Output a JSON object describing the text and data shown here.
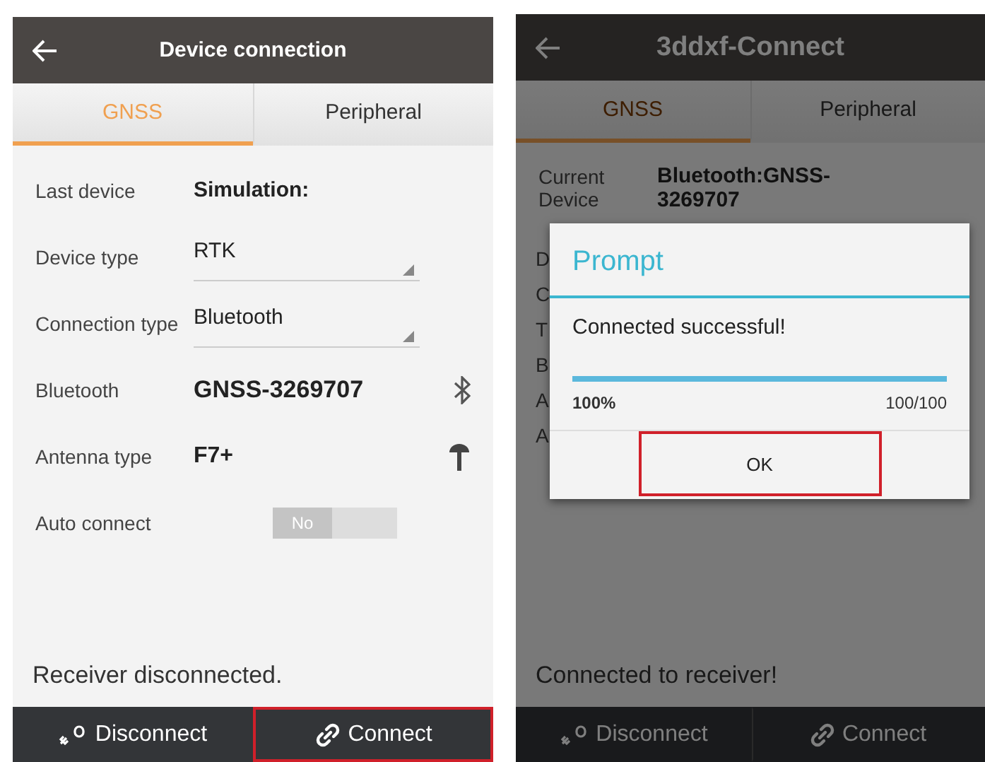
{
  "screens": [
    {
      "title": "Device connection",
      "tabs": [
        {
          "label": "GNSS",
          "selected": true
        },
        {
          "label": "Peripheral",
          "selected": false
        }
      ],
      "fields": [
        {
          "kind": "text",
          "label": "Last device",
          "value": "Simulation:"
        },
        {
          "kind": "dropdown",
          "label": "Device type",
          "value": "RTK"
        },
        {
          "kind": "dropdown",
          "label": "Connection type",
          "value": "Bluetooth"
        },
        {
          "kind": "bluetooth",
          "label": "Bluetooth",
          "value": "GNSS-3269707"
        },
        {
          "kind": "antenna",
          "label": "Antenna type",
          "value": "F7+"
        },
        {
          "kind": "toggle",
          "label": "Auto connect",
          "value": "No",
          "on": false
        }
      ],
      "status": "Receiver disconnected.",
      "buttons": [
        {
          "kind": "disconnect",
          "label": "Disconnect",
          "highlighted": false
        },
        {
          "kind": "connect",
          "label": "Connect",
          "highlighted": true
        }
      ]
    },
    {
      "title": "3ddxf-Connect",
      "tabs": [
        {
          "label": "GNSS",
          "selected": true
        },
        {
          "label": "Peripheral",
          "selected": false
        }
      ],
      "fields": [
        {
          "kind": "text",
          "label": "Current Device",
          "value": "Bluetooth:GNSS-3269707"
        },
        {
          "kind": "partial",
          "label": "D"
        },
        {
          "kind": "partial",
          "label": "C"
        },
        {
          "kind": "partial",
          "label": "T"
        },
        {
          "kind": "partial",
          "label": "B"
        },
        {
          "kind": "partial",
          "label": "A"
        },
        {
          "kind": "partial",
          "label": "A"
        }
      ],
      "status": "Connected to receiver!",
      "buttons": [
        {
          "kind": "disconnect",
          "label": "Disconnect",
          "highlighted": false
        },
        {
          "kind": "connect",
          "label": "Connect",
          "highlighted": false
        }
      ],
      "dialog": {
        "title": "Prompt",
        "message": "Connected successful!",
        "level": 1,
        "percent": "100%",
        "count": "100/100",
        "button": {
          "label": "OK",
          "highlighted": true
        }
      }
    }
  ]
}
